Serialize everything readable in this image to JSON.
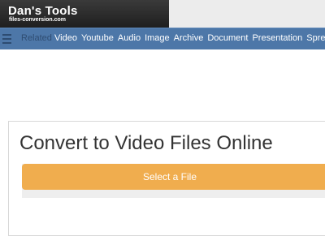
{
  "header": {
    "logo_title": "Dan's Tools",
    "logo_subtitle": "files-conversion.com"
  },
  "nav": {
    "menu_icon": "hamburger-menu-icon",
    "related_label": "Related",
    "items": [
      "Video",
      "Youtube",
      "Audio",
      "Image",
      "Archive",
      "Document",
      "Presentation",
      "Spreadsheet"
    ]
  },
  "main": {
    "title": "Convert to Video Files Online",
    "select_button_label": "Select a File"
  },
  "colors": {
    "nav_bg": "#4d77a8",
    "header_dark": "#2a2a2a",
    "button_orange": "#f0ad4e"
  }
}
